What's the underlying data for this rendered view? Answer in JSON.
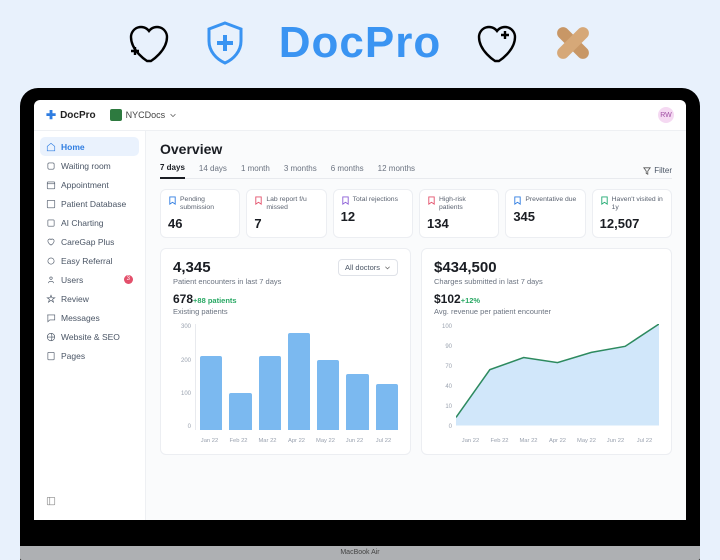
{
  "hero": {
    "title": "DocPro"
  },
  "topbar": {
    "logo": "DocPro",
    "org": "NYCDocs",
    "avatar": "RW"
  },
  "sidebar": {
    "items": [
      {
        "label": "Home",
        "active": true
      },
      {
        "label": "Waiting room"
      },
      {
        "label": "Appointment"
      },
      {
        "label": "Patient Database"
      },
      {
        "label": "AI Charting"
      },
      {
        "label": "CareGap Plus"
      },
      {
        "label": "Easy Referral"
      },
      {
        "label": "Users",
        "badge": "3"
      },
      {
        "label": "Review"
      },
      {
        "label": "Messages"
      },
      {
        "label": "Website & SEO"
      },
      {
        "label": "Pages"
      }
    ]
  },
  "overview": {
    "title": "Overview",
    "tabs": [
      "7 days",
      "14 days",
      "1 month",
      "3 months",
      "6 months",
      "12 months"
    ],
    "active_tab": 0,
    "filter_label": "Filter"
  },
  "stats": [
    {
      "label": "Pending submission",
      "value": "46",
      "color": "#2f7de1"
    },
    {
      "label": "Lab report f/u missed",
      "value": "7",
      "color": "#e3506b"
    },
    {
      "label": "Total rejections",
      "value": "12",
      "color": "#8a5cd6"
    },
    {
      "label": "High-risk patients",
      "value": "134",
      "color": "#e3506b"
    },
    {
      "label": "Preventative due",
      "value": "345",
      "color": "#2f7de1"
    },
    {
      "label": "Haven't visited in 1y",
      "value": "12,507",
      "color": "#1fa971"
    }
  ],
  "left_card": {
    "big": "4,345",
    "big_sub": "Patient encounters in last 7 days",
    "mid": "678",
    "mid_delta": "+88 patients",
    "mid_sub": "Existing patients",
    "dropdown": "All doctors"
  },
  "right_card": {
    "big": "$434,500",
    "big_sub": "Charges submitted in last 7 days",
    "mid": "$102",
    "mid_delta": "+12%",
    "mid_sub": "Avg. revenue per patient encounter"
  },
  "chart_data": [
    {
      "type": "bar",
      "categories": [
        "Jan 22",
        "Feb 22",
        "Mar 22",
        "Apr 22",
        "May 22",
        "Jun 22",
        "Jul 22"
      ],
      "values": [
        210,
        105,
        210,
        275,
        200,
        160,
        130
      ],
      "ylim": [
        0,
        300
      ],
      "yticks": [
        0,
        100,
        200,
        300
      ],
      "title": "Patient encounters",
      "xlabel": "",
      "ylabel": ""
    },
    {
      "type": "area",
      "categories": [
        "Jan 22",
        "Feb 22",
        "Mar 22",
        "Apr 22",
        "May 22",
        "Jun 22",
        "Jul 22"
      ],
      "values": [
        8,
        55,
        67,
        62,
        72,
        78,
        100
      ],
      "ylim": [
        0,
        100
      ],
      "yticks": [
        0,
        10,
        40,
        70,
        90,
        100
      ],
      "title": "Avg. revenue per patient encounter",
      "xlabel": "",
      "ylabel": ""
    }
  ],
  "device": "MacBook Air"
}
